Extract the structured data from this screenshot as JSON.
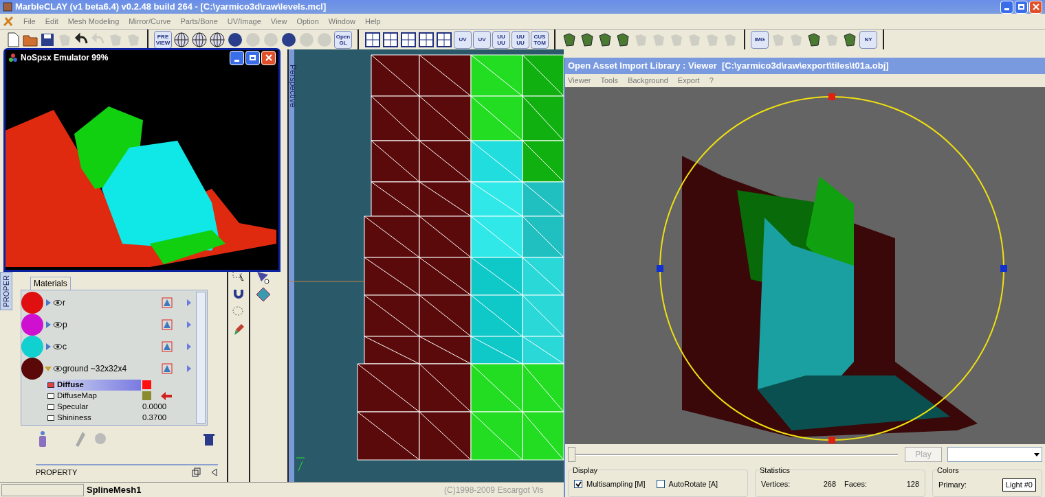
{
  "main_window": {
    "title": "MarbleCLAY (v1 beta6.4) v0.2.48 build 264 - [C:\\yarmico3d\\raw\\levels.mcl]"
  },
  "menu": [
    "File",
    "Edit",
    "Mesh Modeling",
    "Mirror/Curve",
    "Parts/Bone",
    "UV/Image",
    "View",
    "Option",
    "Window",
    "Help"
  ],
  "toolbar_groups": [
    [
      {
        "kind": "page",
        "disabled": false
      },
      {
        "kind": "folder",
        "disabled": false
      },
      {
        "kind": "disk",
        "disabled": false
      },
      {
        "kind": "blob",
        "disabled": true
      },
      {
        "kind": "undo",
        "disabled": false
      },
      {
        "kind": "undo",
        "disabled": true
      },
      {
        "kind": "blob",
        "disabled": true
      },
      {
        "kind": "blob",
        "disabled": true
      }
    ],
    [
      {
        "kind": "label",
        "label": "PRE VIEW",
        "disabled": false
      },
      {
        "kind": "globe",
        "disabled": false
      },
      {
        "kind": "globe",
        "disabled": false
      },
      {
        "kind": "globe",
        "disabled": false
      },
      {
        "kind": "sphere",
        "disabled": false
      },
      {
        "kind": "sphere",
        "disabled": true
      },
      {
        "kind": "sphere",
        "disabled": true
      },
      {
        "kind": "sphere",
        "disabled": false
      },
      {
        "kind": "sphere",
        "disabled": true
      },
      {
        "kind": "sphere",
        "disabled": true
      },
      {
        "kind": "label",
        "label": "Open GL",
        "disabled": false
      }
    ],
    [
      {
        "kind": "layout",
        "disabled": false
      },
      {
        "kind": "layout",
        "disabled": false
      },
      {
        "kind": "layout",
        "disabled": false
      },
      {
        "kind": "layout",
        "disabled": false
      },
      {
        "kind": "layout",
        "disabled": false
      },
      {
        "kind": "label",
        "label": "UV",
        "disabled": false
      },
      {
        "kind": "label",
        "label": "UV",
        "disabled": false
      },
      {
        "kind": "label",
        "label": "UU UU",
        "disabled": false
      },
      {
        "kind": "label",
        "label": "UU UU",
        "disabled": false
      },
      {
        "kind": "label",
        "label": "CUS TOM",
        "disabled": false
      }
    ],
    [
      {
        "kind": "shape",
        "disabled": false
      },
      {
        "kind": "shape",
        "disabled": false
      },
      {
        "kind": "shape",
        "disabled": false
      },
      {
        "kind": "shape",
        "disabled": false
      },
      {
        "kind": "blob",
        "disabled": true
      },
      {
        "kind": "blob",
        "disabled": true
      },
      {
        "kind": "blob",
        "disabled": true
      },
      {
        "kind": "blob",
        "disabled": true
      },
      {
        "kind": "blob",
        "disabled": true
      },
      {
        "kind": "blob",
        "disabled": true
      }
    ],
    [
      {
        "kind": "label",
        "label": "IMG",
        "disabled": false
      },
      {
        "kind": "blob",
        "disabled": true
      },
      {
        "kind": "blob",
        "disabled": true
      },
      {
        "kind": "shape",
        "disabled": false
      },
      {
        "kind": "blob",
        "disabled": true
      },
      {
        "kind": "shape",
        "disabled": false
      },
      {
        "kind": "label",
        "label": "NY",
        "disabled": false
      }
    ]
  ],
  "side_tab": "PROPER",
  "materials": {
    "title": "Materials",
    "items": [
      {
        "name": "r",
        "color": "#e01010",
        "expanded": false
      },
      {
        "name": "p",
        "color": "#d010d0",
        "expanded": false
      },
      {
        "name": "c",
        "color": "#10d0d0",
        "expanded": false
      },
      {
        "name": "ground ~32x32x4",
        "color": "#5a0808",
        "expanded": true,
        "children": [
          {
            "name": "Diffuse",
            "kind": "color",
            "color": "#ff1010",
            "selected": true
          },
          {
            "name": "DiffuseMap",
            "kind": "texture",
            "selected": false
          },
          {
            "name": "Specular",
            "kind": "value",
            "value": "0.0000",
            "selected": false
          },
          {
            "name": "Shininess",
            "kind": "value",
            "value": "0.3700",
            "selected": false
          }
        ]
      }
    ]
  },
  "property_footer": "PROPERTY",
  "viewport_label": "Perspective",
  "status_bar": [
    "SplineMesh1",
    "(C)1998-2009 Escargot Vis"
  ],
  "emulator": {
    "title": "NoSpsx Emulator 99%"
  },
  "viewer": {
    "title": "Open Asset Import Library : Viewer  [C:\\yarmico3d\\raw\\export\\tiles\\t01a.obj]",
    "menu": [
      "Viewer",
      "Tools",
      "Background",
      "Export",
      "?"
    ],
    "timeline": {
      "level": 0.0
    },
    "play": {
      "label": "Play",
      "disabled": true
    },
    "display": {
      "title": "Display",
      "options": [
        {
          "label": "Multisampling [M]",
          "checked": true
        },
        {
          "label": "AutoRotate [A]",
          "checked": false
        }
      ]
    },
    "statistics": {
      "title": "Statistics",
      "rows": [
        {
          "label": "Vertices:",
          "value": "268"
        },
        {
          "label": "Faces:",
          "value": "128"
        }
      ]
    },
    "colors": {
      "title": "Colors",
      "label": "Primary:",
      "value": "Light #0"
    }
  }
}
